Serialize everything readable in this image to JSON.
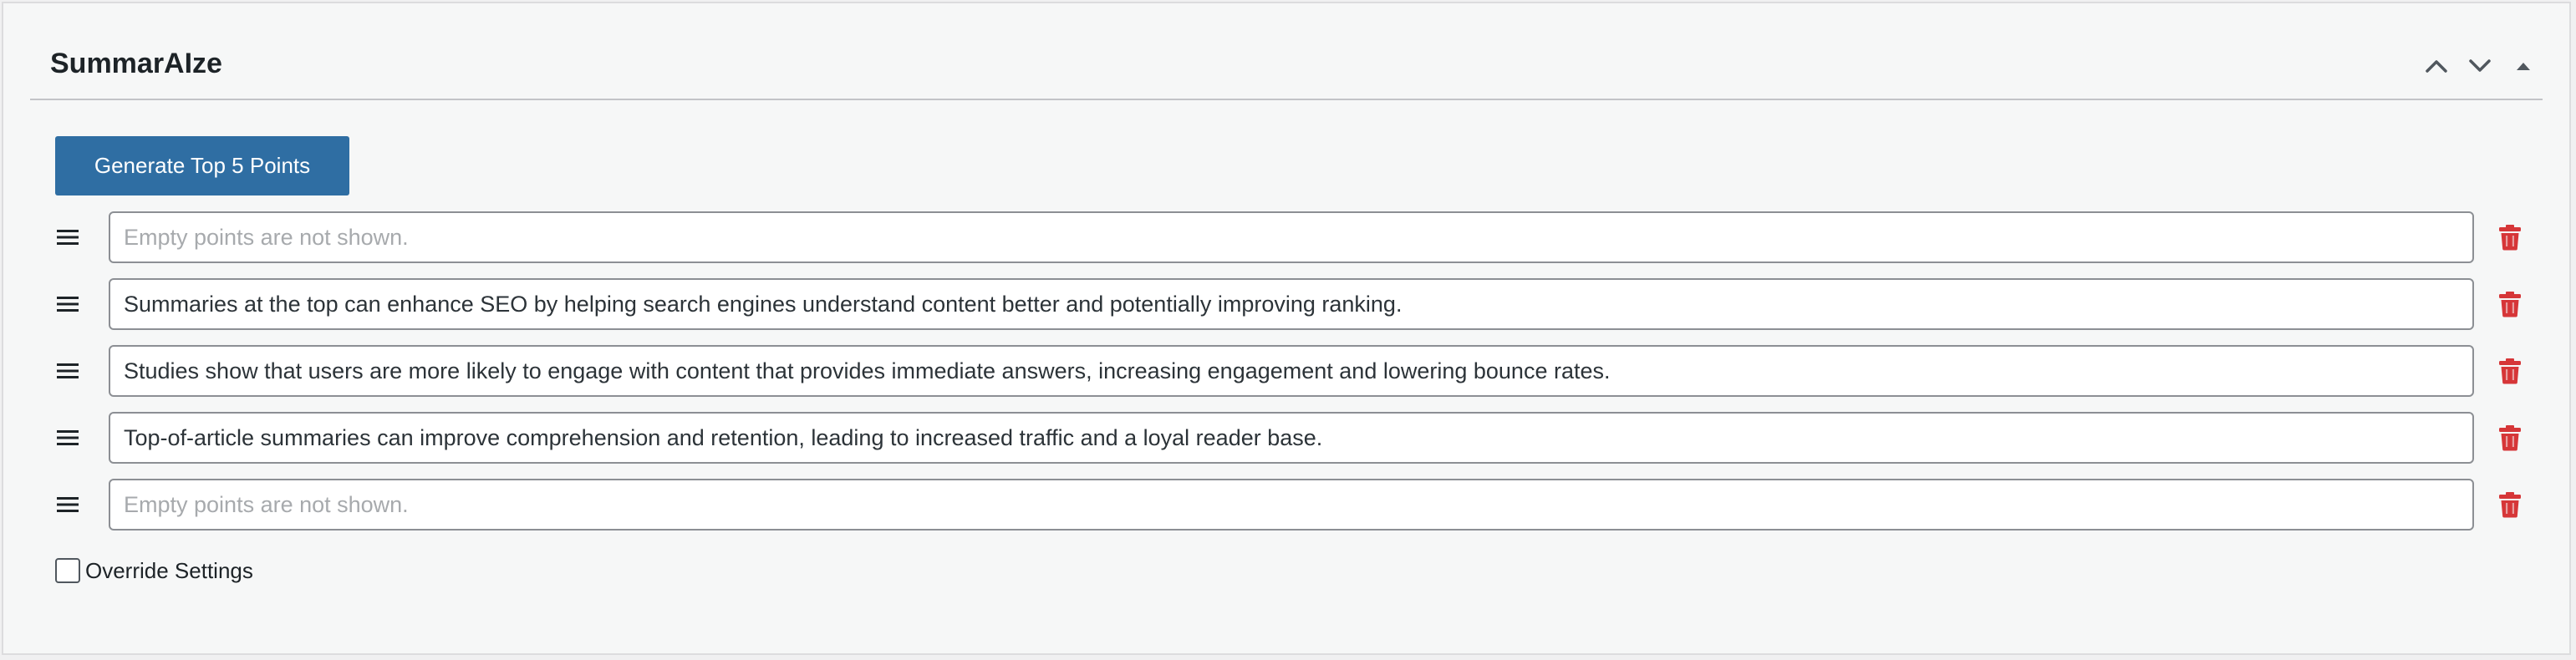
{
  "panel": {
    "title": "SummarAIze",
    "actions": [
      {
        "name": "move-up",
        "icon": "chevron-up-icon"
      },
      {
        "name": "move-down",
        "icon": "chevron-down-icon"
      },
      {
        "name": "toggle-panel",
        "icon": "triangle-up-icon"
      }
    ]
  },
  "generate_button": {
    "label": "Generate Top 5 Points"
  },
  "points": [
    {
      "value": "",
      "placeholder": "Empty points are not shown."
    },
    {
      "value": "Summaries at the top can enhance SEO by helping search engines understand content better and potentially improving ranking.",
      "placeholder": "Empty points are not shown."
    },
    {
      "value": "Studies show that users are more likely to engage with content that provides immediate answers, increasing engagement and lowering bounce rates.",
      "placeholder": "Empty points are not shown."
    },
    {
      "value": "Top-of-article summaries can improve comprehension and retention, leading to increased traffic and a loyal reader base.",
      "placeholder": "Empty points are not shown."
    },
    {
      "value": "",
      "placeholder": "Empty points are not shown."
    }
  ],
  "row_icons": {
    "drag": "drag-handle-icon",
    "delete": "trash-icon"
  },
  "override": {
    "label": "Override Settings",
    "checked": false
  },
  "colors": {
    "primary_button": "#2f6ea3",
    "delete_icon": "#d63638",
    "panel_background": "#f6f7f7"
  }
}
